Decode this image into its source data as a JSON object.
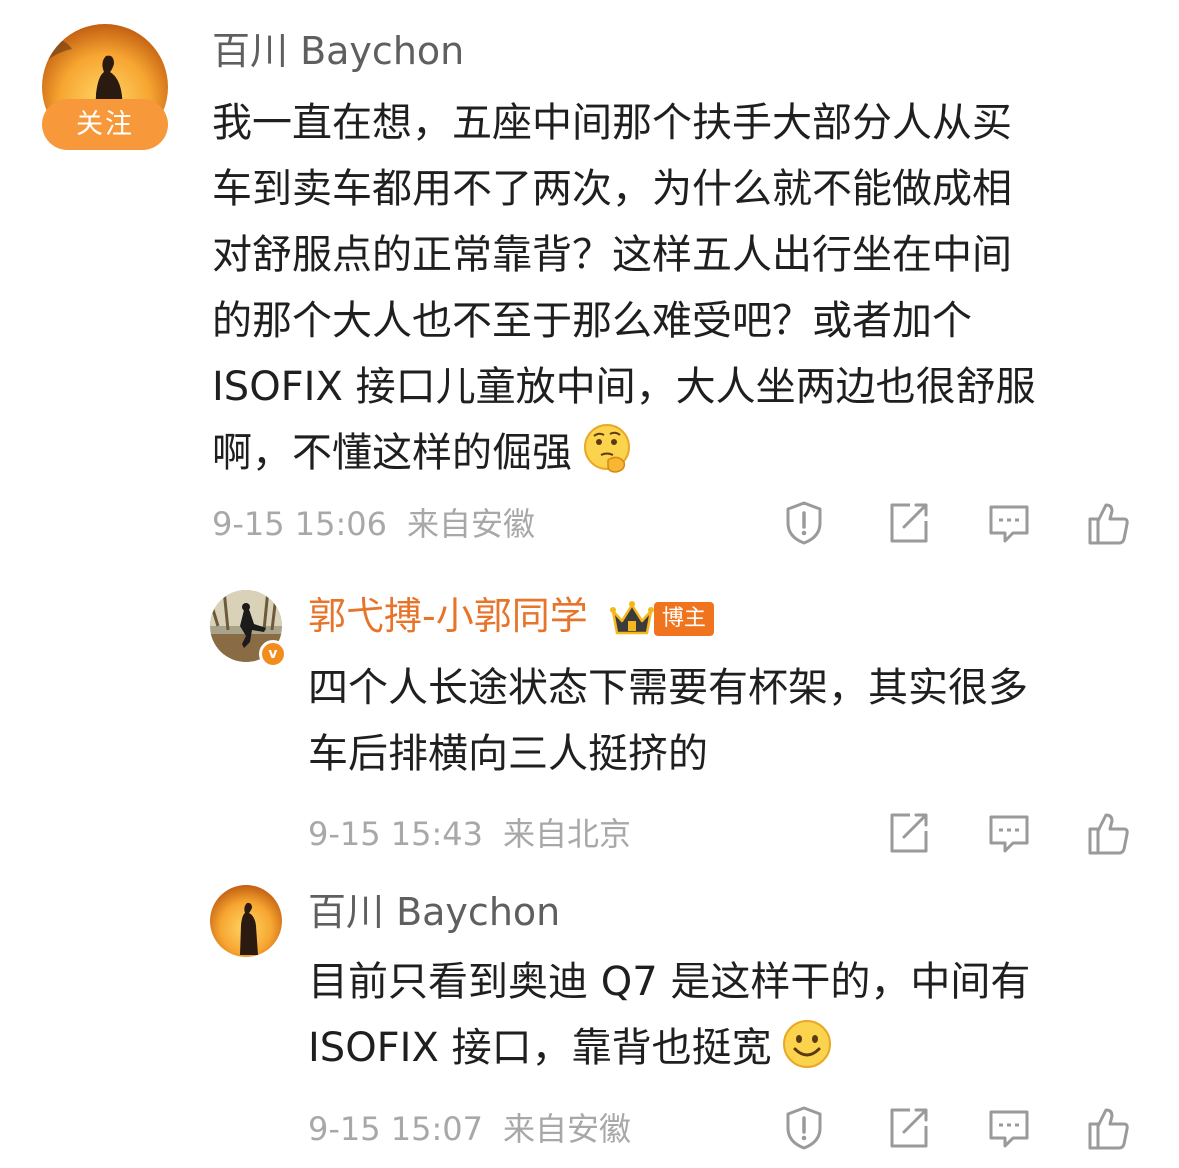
{
  "comment": {
    "author": "百川 Baychon",
    "follow_label": "关注",
    "lines": [
      "我一直在想，五座中间那个扶手大部分人从买",
      "车到卖车都用不了两次，为什么就不能做成相",
      "对舒服点的正常靠背？这样五人出行坐在中间",
      "的那个大人也不至于那么难受吧？或者加个",
      "ISOFIX 接口儿童放中间，大人坐两边也很舒服",
      "啊，不懂这样的倔强"
    ],
    "time": "9-15 15:06",
    "location": "来自安徽"
  },
  "replies": [
    {
      "author": "郭弋搏-小郭同学",
      "badge": "博主",
      "lines": [
        "四个人长途状态下需要有杯架，其实很多",
        "车后排横向三人挺挤的"
      ],
      "time": "9-15 15:43",
      "location": "来自北京"
    },
    {
      "author": "百川 Baychon",
      "lines": [
        "目前只看到奥迪 Q7 是这样干的，中间有",
        "ISOFIX 接口，靠背也挺宽"
      ],
      "time": "9-15 15:07",
      "location": "来自安徽"
    }
  ],
  "icons": {
    "report": "report-icon",
    "share": "share-icon",
    "comment": "comment-icon",
    "like": "like-icon"
  },
  "colors": {
    "accent": "#f7983a",
    "vip_name": "#e8742a",
    "meta_text": "#a8a8a8"
  }
}
